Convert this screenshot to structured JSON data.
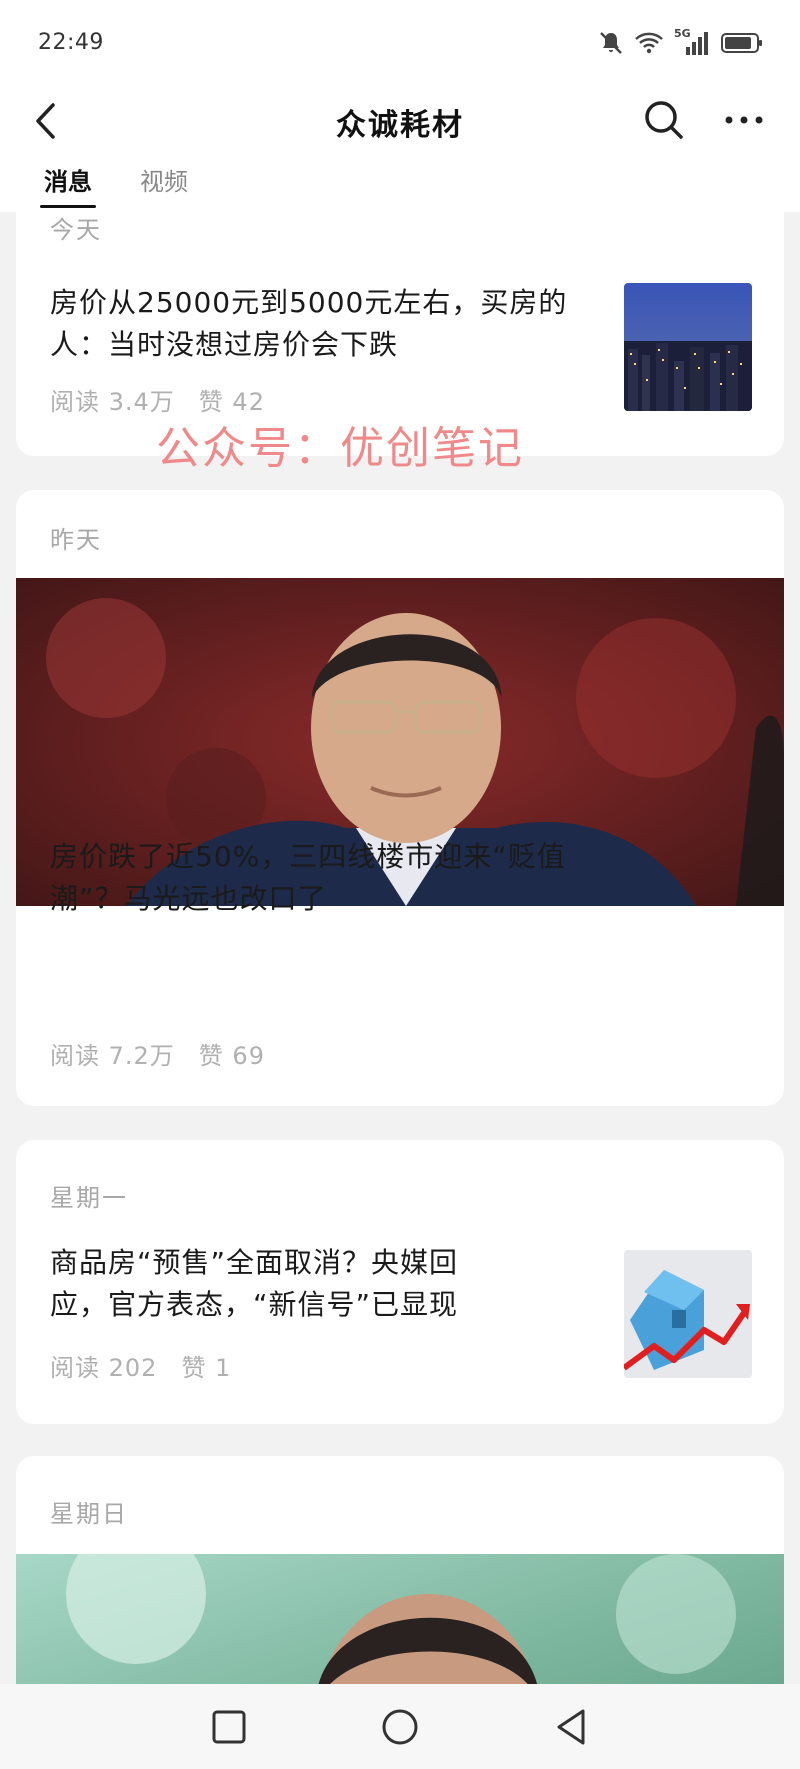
{
  "status": {
    "time": "22:49",
    "network": "5G"
  },
  "header": {
    "title": "众诚耗材"
  },
  "tabs": [
    {
      "label": "消息"
    },
    {
      "label": "视频"
    }
  ],
  "watermark": "公众号：优创笔记",
  "feed": [
    {
      "date": "今天",
      "title_lines": [
        "房价从25000元到5000元左右，买房的",
        "人：当时没想过房价会下跌"
      ],
      "reads": "阅读 3.4万",
      "likes": "赞 42",
      "thumb": "city-night-thumbnail"
    },
    {
      "date": "昨天",
      "title_lines": [
        "房价跌了近50%，三四线楼市迎来“贬值",
        "潮”？马光远也改口了"
      ],
      "reads": "阅读 7.2万",
      "likes": "赞 69",
      "cover": "man-portrait-cover"
    },
    {
      "date": "星期一",
      "title_lines": [
        "商品房“预售”全面取消？央媒回",
        "应，官方表态，“新信号”已显现"
      ],
      "reads": "阅读 202",
      "likes": "赞 1",
      "thumb": "house-chart-thumbnail"
    },
    {
      "date": "星期日",
      "cover": "man-portrait-cover"
    }
  ],
  "colors": {
    "accent": "#111111",
    "muted": "#a8a8a8",
    "watermark": "#f08a8a",
    "background": "#f2f2f2"
  }
}
